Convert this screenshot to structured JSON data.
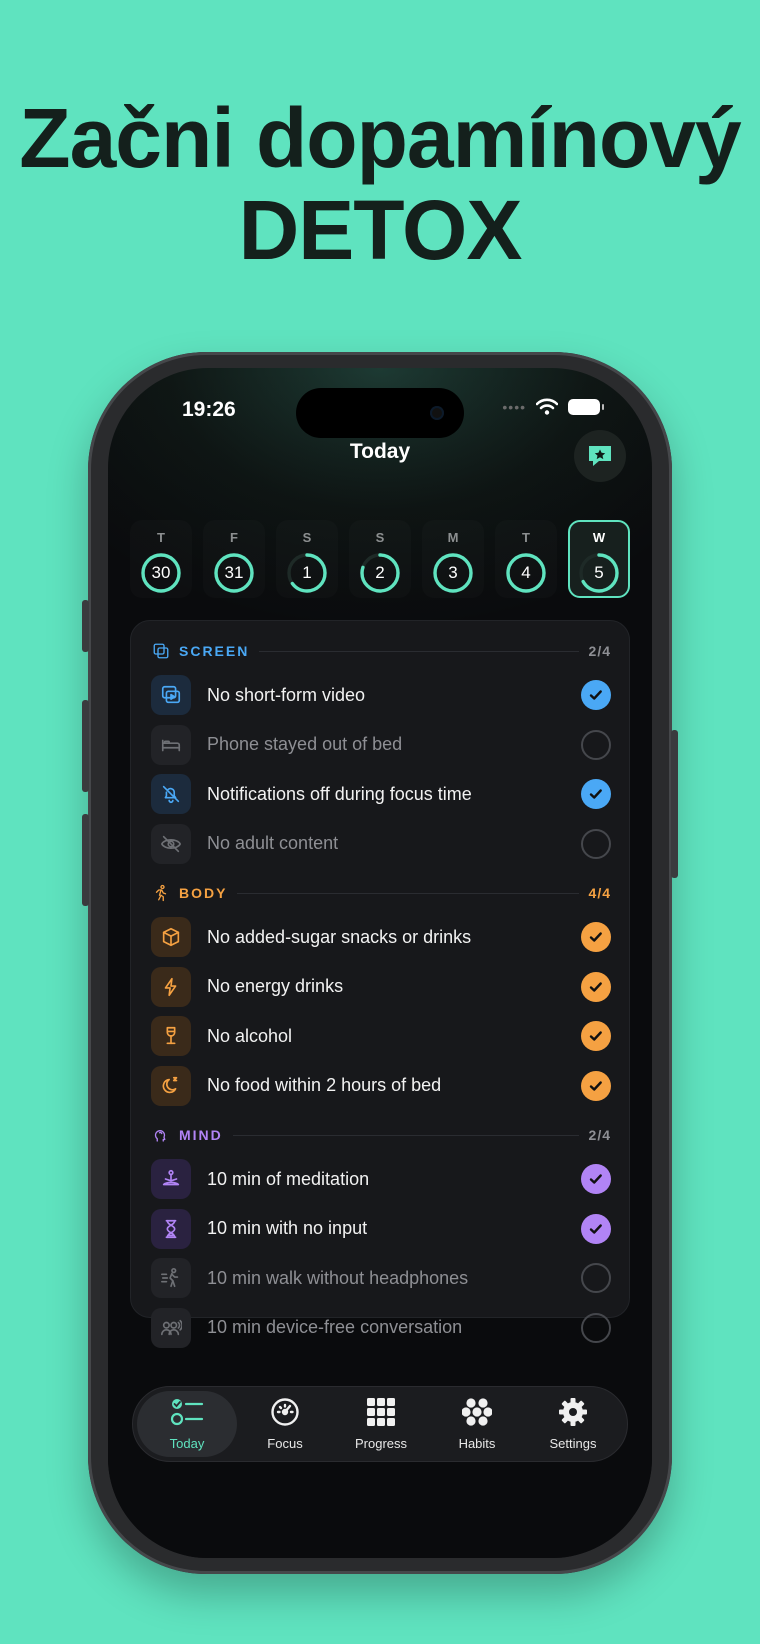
{
  "headline": {
    "line1": "Začni dopamínový",
    "line2": "DETOX"
  },
  "status_bar": {
    "time": "19:26",
    "signal": "••••"
  },
  "nav": {
    "title": "Today"
  },
  "colors": {
    "accent": "#5fe3bf",
    "screen": "#4aa8f5",
    "body": "#f5a142",
    "mind": "#b184f5",
    "background": "#5fe3bf"
  },
  "week": [
    {
      "letter": "T",
      "date": "30",
      "progress": 1.0,
      "selected": false
    },
    {
      "letter": "F",
      "date": "31",
      "progress": 1.0,
      "selected": false
    },
    {
      "letter": "S",
      "date": "1",
      "progress": 0.65,
      "selected": false
    },
    {
      "letter": "S",
      "date": "2",
      "progress": 0.8,
      "selected": false
    },
    {
      "letter": "M",
      "date": "3",
      "progress": 1.0,
      "selected": false
    },
    {
      "letter": "T",
      "date": "4",
      "progress": 1.0,
      "selected": false
    },
    {
      "letter": "W",
      "date": "5",
      "progress": 0.67,
      "selected": true
    }
  ],
  "sections": [
    {
      "key": "screen",
      "label": "SCREEN",
      "count": "2/4",
      "icon": "screens-icon",
      "items": [
        {
          "label": "No short-form video",
          "done": true,
          "icon": "video-play-icon"
        },
        {
          "label": "Phone stayed out of bed",
          "done": false,
          "icon": "bed-icon"
        },
        {
          "label": "Notifications off during focus time",
          "done": true,
          "icon": "bell-off-icon"
        },
        {
          "label": "No adult content",
          "done": false,
          "icon": "eye-off-icon"
        }
      ]
    },
    {
      "key": "body",
      "label": "BODY",
      "count": "4/4",
      "icon": "running-icon",
      "items": [
        {
          "label": "No added-sugar snacks or drinks",
          "done": true,
          "icon": "cube-icon"
        },
        {
          "label": "No energy drinks",
          "done": true,
          "icon": "bolt-icon"
        },
        {
          "label": "No alcohol",
          "done": true,
          "icon": "wine-glass-icon"
        },
        {
          "label": "No food within 2 hours of bed",
          "done": true,
          "icon": "moon-sleep-icon"
        }
      ]
    },
    {
      "key": "mind",
      "label": "MIND",
      "count": "2/4",
      "icon": "head-icon",
      "items": [
        {
          "label": "10 min of meditation",
          "done": true,
          "icon": "meditation-icon"
        },
        {
          "label": "10 min with no input",
          "done": true,
          "icon": "hourglass-icon"
        },
        {
          "label": "10 min walk without headphones",
          "done": false,
          "icon": "walking-icon"
        },
        {
          "label": "10 min device-free conversation",
          "done": false,
          "icon": "people-talking-icon"
        }
      ]
    }
  ],
  "tabs": [
    {
      "label": "Today",
      "icon": "checklist-icon",
      "active": true
    },
    {
      "label": "Focus",
      "icon": "gauge-icon",
      "active": false
    },
    {
      "label": "Progress",
      "icon": "grid-icon",
      "active": false
    },
    {
      "label": "Habits",
      "icon": "flower-icon",
      "active": false
    },
    {
      "label": "Settings",
      "icon": "gear-icon",
      "active": false
    }
  ]
}
